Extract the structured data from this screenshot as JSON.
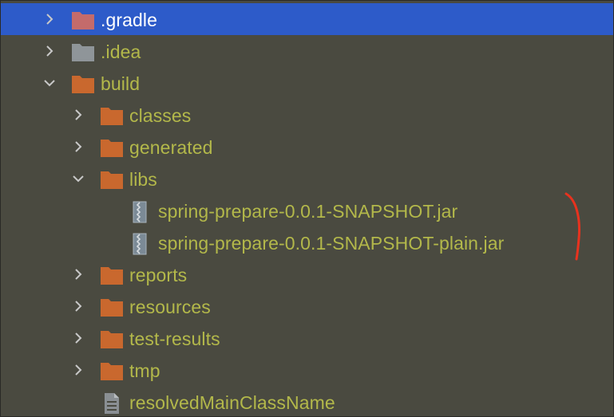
{
  "project_tree": {
    "items": [
      {
        "label": ".gradle",
        "expanded": false,
        "selected": true,
        "type": "folder",
        "icon": "folder-icon",
        "icon_color": "#c46b6b"
      },
      {
        "label": ".idea",
        "expanded": false,
        "selected": false,
        "type": "folder",
        "icon": "folder-icon",
        "icon_color": "#8f9599"
      },
      {
        "label": "build",
        "expanded": true,
        "selected": false,
        "type": "folder",
        "icon": "folder-icon",
        "icon_color": "#c9682e"
      },
      {
        "label": "classes",
        "expanded": false,
        "selected": false,
        "type": "folder",
        "icon": "folder-icon",
        "icon_color": "#c9682e"
      },
      {
        "label": "generated",
        "expanded": false,
        "selected": false,
        "type": "folder",
        "icon": "folder-icon",
        "icon_color": "#c9682e"
      },
      {
        "label": "libs",
        "expanded": true,
        "selected": false,
        "type": "folder",
        "icon": "folder-icon",
        "icon_color": "#c9682e"
      },
      {
        "label": "spring-prepare-0.0.1-SNAPSHOT.jar",
        "selected": false,
        "type": "file",
        "icon": "jar-archive-icon"
      },
      {
        "label": "spring-prepare-0.0.1-SNAPSHOT-plain.jar",
        "selected": false,
        "type": "file",
        "icon": "jar-archive-icon"
      },
      {
        "label": "reports",
        "expanded": false,
        "selected": false,
        "type": "folder",
        "icon": "folder-icon",
        "icon_color": "#c9682e"
      },
      {
        "label": "resources",
        "expanded": false,
        "selected": false,
        "type": "folder",
        "icon": "folder-icon",
        "icon_color": "#c9682e"
      },
      {
        "label": "test-results",
        "expanded": false,
        "selected": false,
        "type": "folder",
        "icon": "folder-icon",
        "icon_color": "#c9682e"
      },
      {
        "label": "tmp",
        "expanded": false,
        "selected": false,
        "type": "folder",
        "icon": "folder-icon",
        "icon_color": "#c9682e"
      },
      {
        "label": "resolvedMainClassName",
        "selected": false,
        "type": "file",
        "icon": "text-file-icon"
      }
    ]
  },
  "colors": {
    "background": "#4a4a40",
    "selection": "#2d5bc9",
    "file_text": "#b3b84a",
    "annotation": "#e8321e"
  },
  "annotation": {
    "type": "red-bracket-mark"
  }
}
